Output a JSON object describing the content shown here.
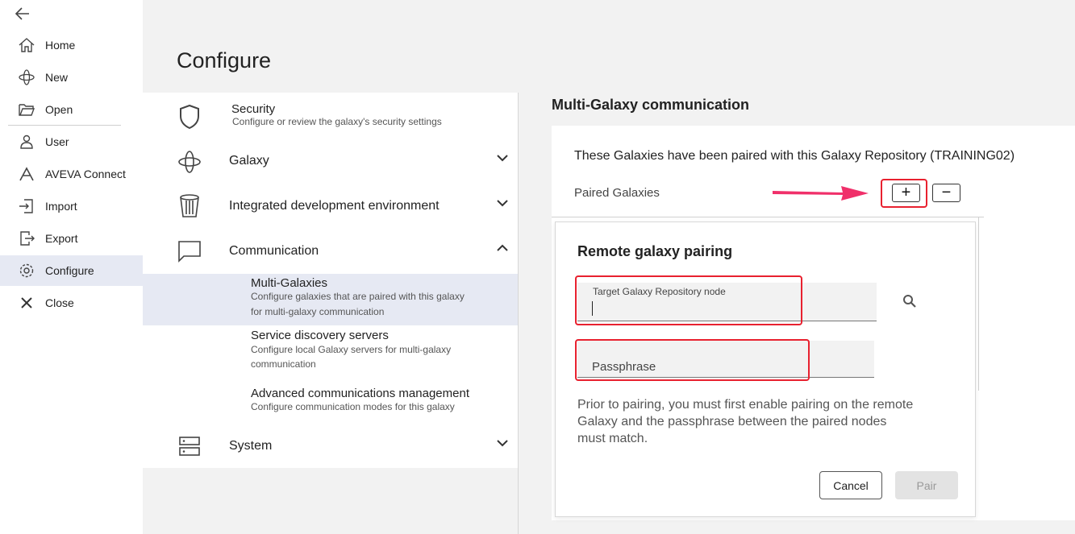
{
  "nav": {
    "items": [
      {
        "label": "Home",
        "icon": "home-icon"
      },
      {
        "label": "New",
        "icon": "new-galaxy-icon"
      },
      {
        "label": "Open",
        "icon": "folder-open-icon"
      },
      {
        "label": "User",
        "icon": "user-icon"
      },
      {
        "label": "AVEVA Connect",
        "icon": "aveva-icon"
      },
      {
        "label": "Import",
        "icon": "import-icon"
      },
      {
        "label": "Export",
        "icon": "export-icon"
      },
      {
        "label": "Configure",
        "icon": "gear-icon"
      },
      {
        "label": "Close",
        "icon": "close-icon"
      }
    ],
    "active": "Configure"
  },
  "page": {
    "title": "Configure"
  },
  "config": {
    "security": {
      "title": "Security",
      "desc": "Configure or review the galaxy's security settings"
    },
    "galaxy": {
      "title": "Galaxy"
    },
    "ide": {
      "title": "Integrated development environment"
    },
    "communication": {
      "title": "Communication"
    },
    "multi": {
      "title": "Multi-Galaxies",
      "desc1": "Configure galaxies that are paired with this galaxy",
      "desc2": "for multi-galaxy communication"
    },
    "sds": {
      "title": "Service discovery servers",
      "desc1": "Configure local Galaxy servers for multi-galaxy",
      "desc2": "communication"
    },
    "acm": {
      "title": "Advanced communications management",
      "desc": "Configure communication modes for this galaxy"
    },
    "system": {
      "title": "System"
    }
  },
  "panel": {
    "title": "Multi-Galaxy communication",
    "desc": "These Galaxies have been paired with this Galaxy Repository (TRAINING02)",
    "paired_label": "Paired Galaxies",
    "add_label": "+",
    "remove_label": "−"
  },
  "modal": {
    "title": "Remote galaxy pairing",
    "node_label": "Target Galaxy Repository node",
    "node_value": "",
    "passphrase_placeholder": "Passphrase",
    "help": "Prior to pairing, you must first enable pairing on the remote Galaxy and the passphrase between the paired nodes must match.",
    "cancel": "Cancel",
    "pair": "Pair"
  },
  "colors": {
    "highlight": "#e8212f",
    "arrow": "#f0306a",
    "active_bg": "#e6e9f3"
  }
}
